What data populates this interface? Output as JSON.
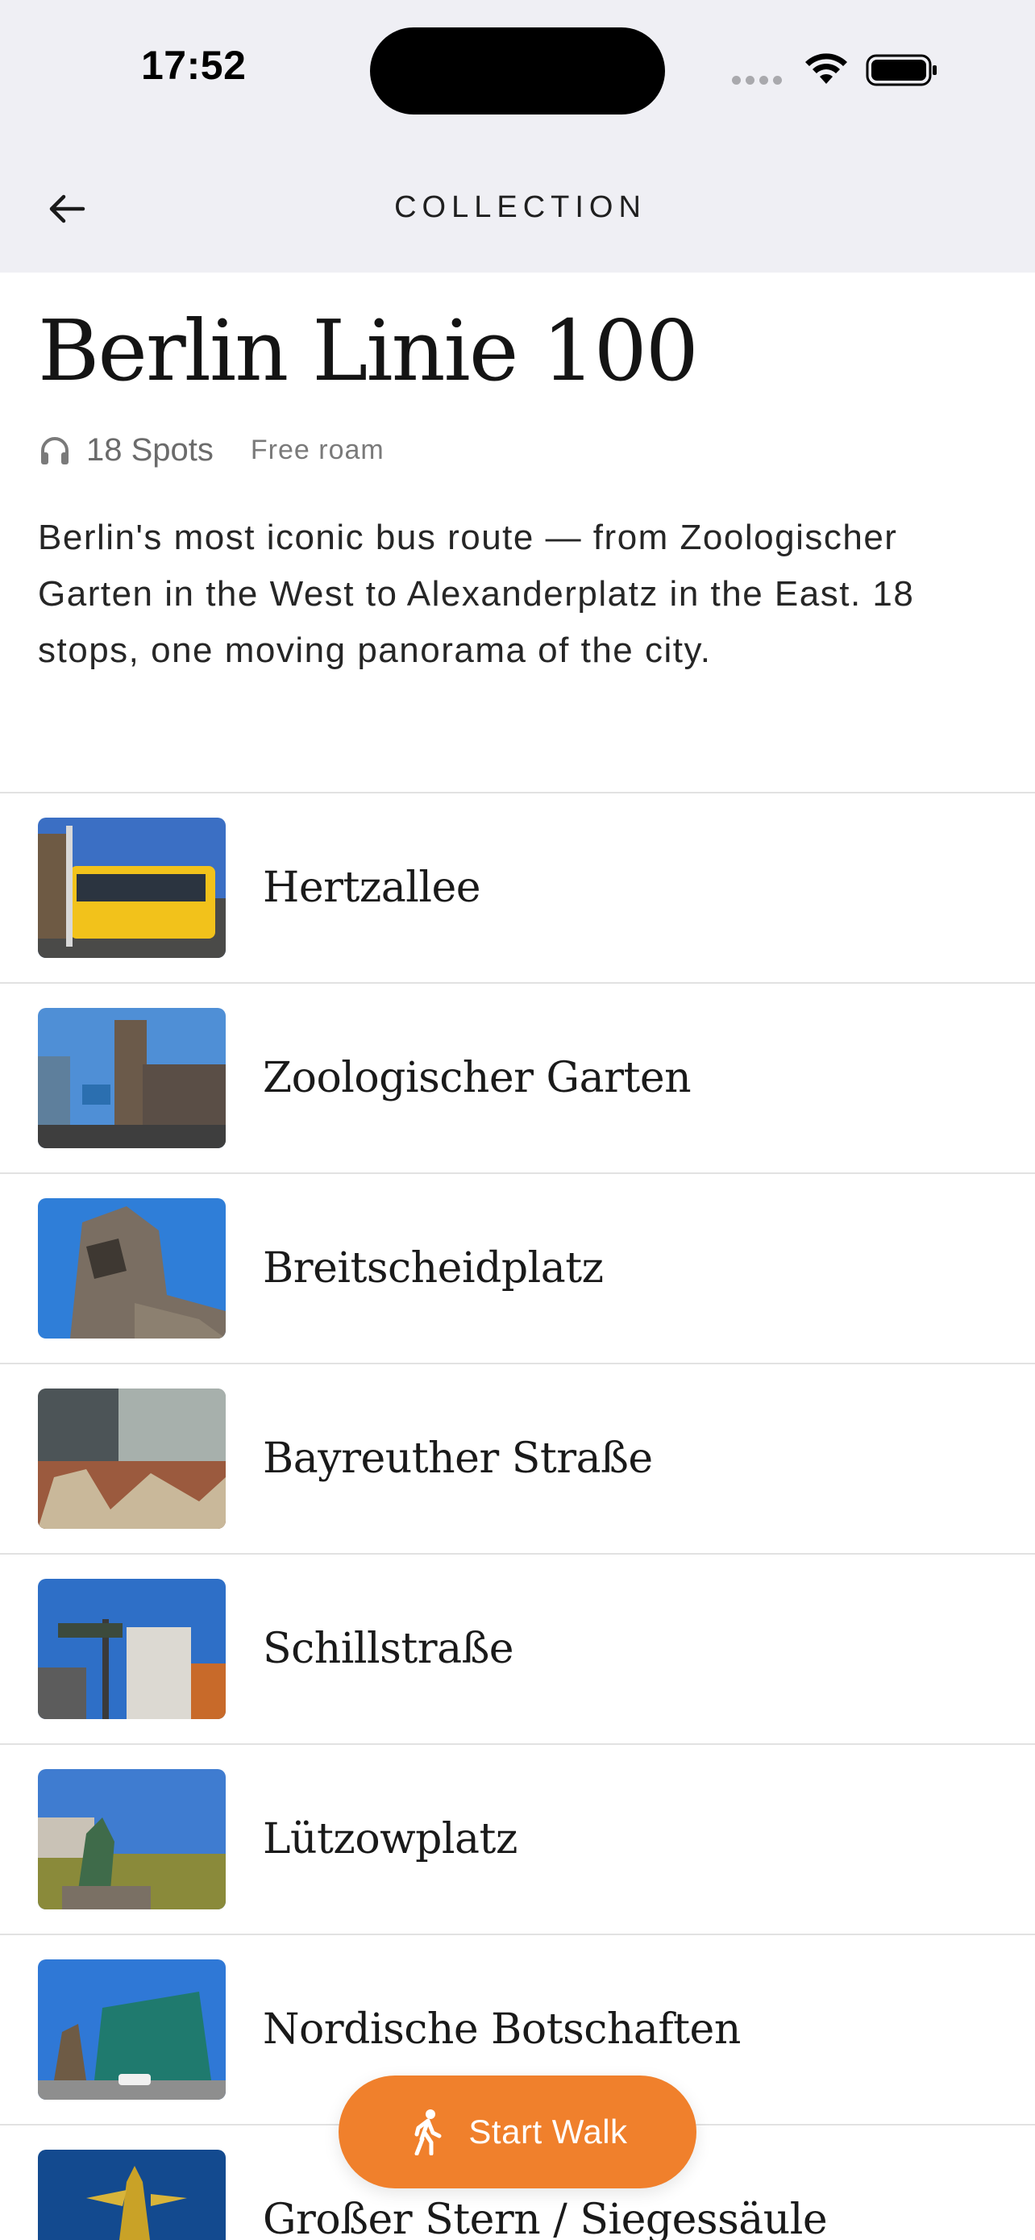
{
  "status_bar": {
    "time": "17:52"
  },
  "nav": {
    "back_icon": "arrow-left-icon",
    "title": "COLLECTION"
  },
  "collection": {
    "title": "Berlin Linie 100",
    "spots_icon": "headphones-icon",
    "spots_count": "18 Spots",
    "mode": "Free roam",
    "description": "Berlin's most iconic bus route — from Zoologischer Garten in the West to Alexanderplatz in the East. 18 stops, one moving panorama of the city."
  },
  "spots": [
    {
      "name": "Hertzallee"
    },
    {
      "name": "Zoologischer Garten"
    },
    {
      "name": "Breitscheidplatz"
    },
    {
      "name": "Bayreuther Straße"
    },
    {
      "name": "Schillstraße"
    },
    {
      "name": "Lützowplatz"
    },
    {
      "name": "Nordische Botschaften"
    },
    {
      "name": "Großer Stern / Siegessäule"
    }
  ],
  "start_walk": {
    "icon": "walking-person-icon",
    "label": "Start Walk"
  },
  "colors": {
    "accent": "#f0802c",
    "chrome_background": "#efeff4",
    "divider": "#e2e2e2"
  }
}
